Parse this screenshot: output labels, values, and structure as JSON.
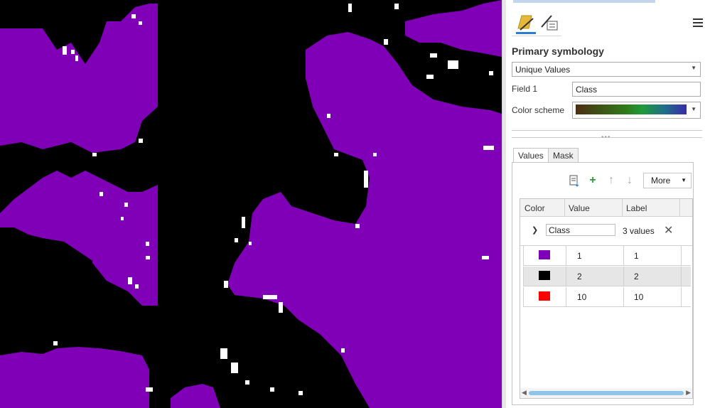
{
  "tools": {
    "symbology_icon": "symbology-brush-icon",
    "vary_icon": "vary-symbology-icon",
    "menu_icon": "hamburger-menu-icon"
  },
  "symbology": {
    "heading": "Primary symbology",
    "renderer": "Unique Values",
    "field_label": "Field 1",
    "field_value": "Class",
    "color_scheme_label": "Color scheme"
  },
  "tabs": [
    {
      "label": "Values"
    },
    {
      "label": "Mask"
    }
  ],
  "toolbar": {
    "more_label": "More"
  },
  "grid": {
    "headers": {
      "color": "Color",
      "value": "Value",
      "label": "Label"
    },
    "group": {
      "field": "Class",
      "count": "3 values"
    },
    "rows": [
      {
        "color": "#8000b8",
        "value": "1",
        "label": "1"
      },
      {
        "color": "#000000",
        "value": "2",
        "label": "2"
      },
      {
        "color": "#ff0000",
        "value": "10",
        "label": "10"
      }
    ]
  },
  "map": {
    "class1_color": "#8000b8",
    "class2_color": "#000000",
    "nodata_color": "#ffffff"
  }
}
